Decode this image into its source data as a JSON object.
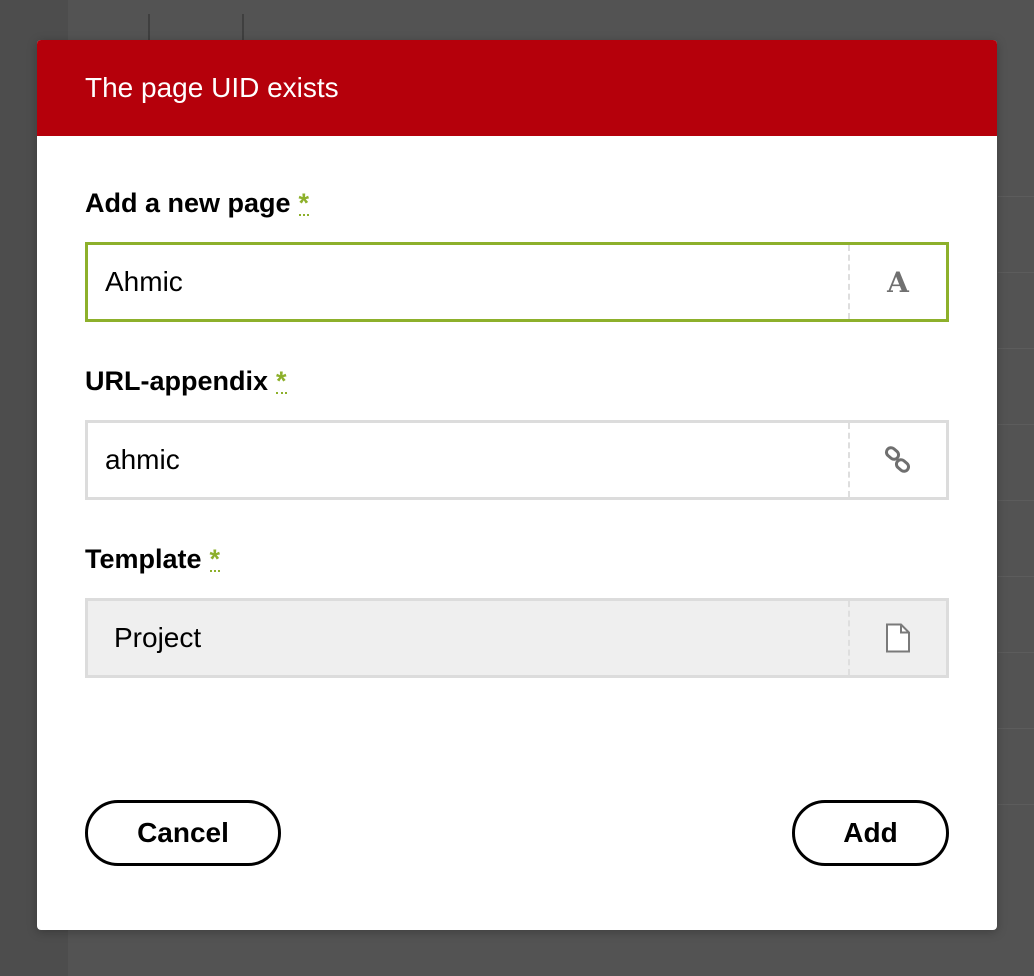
{
  "dialog": {
    "title": "The page UID exists",
    "fields": [
      {
        "label": "Add a new page",
        "required_mark": "*",
        "value": "Ahmic",
        "icon": "title-icon",
        "icon_glyph": "A",
        "state": "focused"
      },
      {
        "label": "URL-appendix",
        "required_mark": "*",
        "value": "ahmic",
        "icon": "link-icon",
        "state": "normal"
      },
      {
        "label": "Template",
        "required_mark": "*",
        "value": "Project",
        "icon": "file-icon",
        "state": "disabled"
      }
    ],
    "cancel_label": "Cancel",
    "add_label": "Add"
  },
  "colors": {
    "header": "#b5000b",
    "accent": "#8db02b",
    "overlay": "#4d4d4d"
  }
}
